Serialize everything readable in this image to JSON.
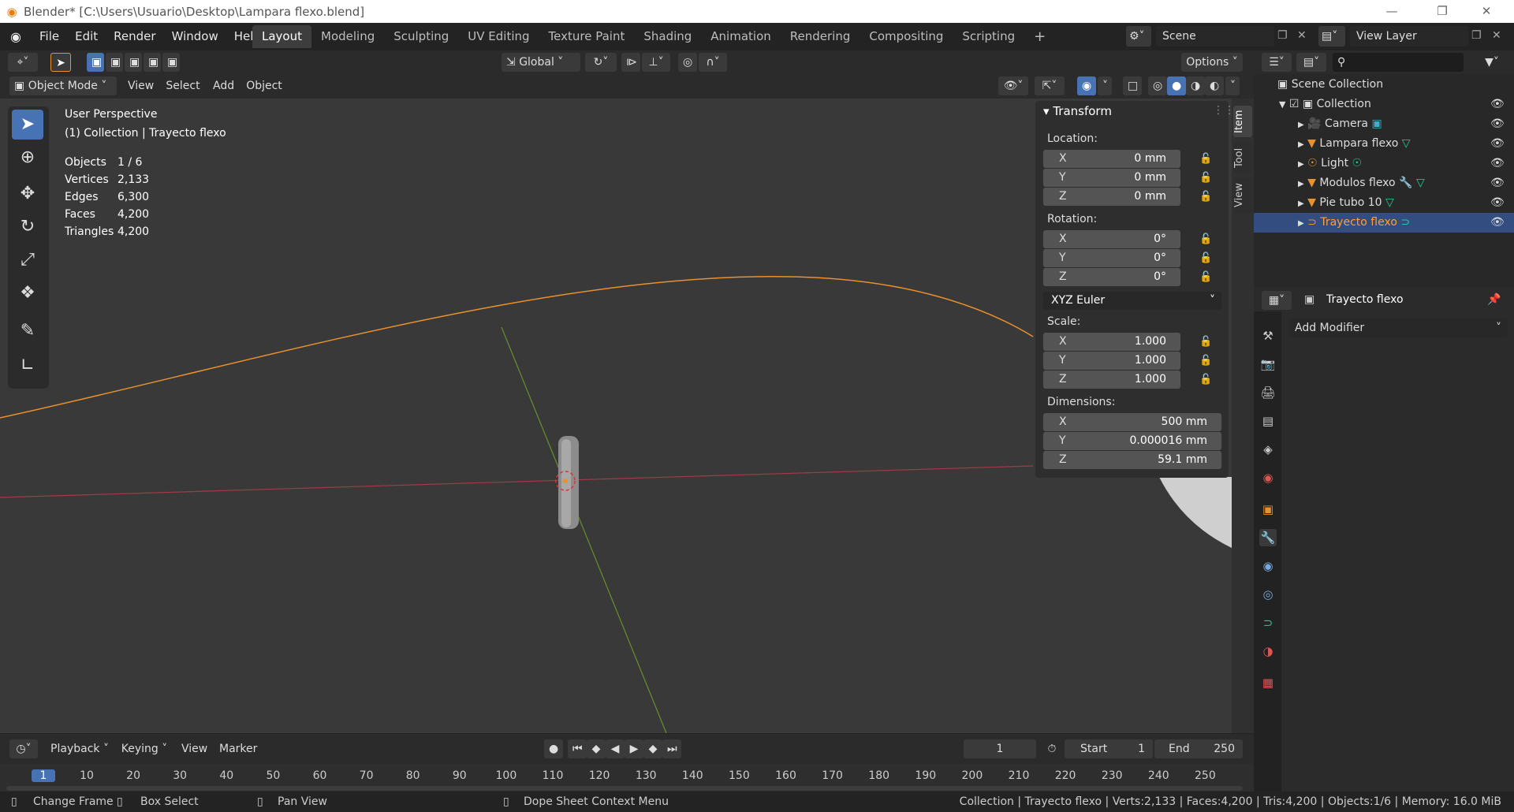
{
  "window": {
    "title": "Blender* [C:\\Users\\Usuario\\Desktop\\Lampara flexo.blend]"
  },
  "menu": {
    "file": "File",
    "edit": "Edit",
    "render": "Render",
    "window": "Window",
    "help": "Help"
  },
  "workspaces": [
    "Layout",
    "Modeling",
    "Sculpting",
    "UV Editing",
    "Texture Paint",
    "Shading",
    "Animation",
    "Rendering",
    "Compositing",
    "Scripting"
  ],
  "scene": {
    "name": "Scene",
    "view_layer": "View Layer"
  },
  "header": {
    "orientation": "Global",
    "options": "Options"
  },
  "viewport_header": {
    "mode": "Object Mode",
    "view": "View",
    "select": "Select",
    "add": "Add",
    "object": "Object"
  },
  "overlay": {
    "perspective": "User Perspective",
    "collection": "(1) Collection | Trayecto flexo",
    "stats": [
      {
        "label": "Objects",
        "value": "1 / 6"
      },
      {
        "label": "Vertices",
        "value": "2,133"
      },
      {
        "label": "Edges",
        "value": "6,300"
      },
      {
        "label": "Faces",
        "value": "4,200"
      },
      {
        "label": "Triangles",
        "value": "4,200"
      }
    ]
  },
  "npanel": {
    "title": "Transform",
    "tabs": [
      "Item",
      "Tool",
      "View"
    ],
    "location_label": "Location:",
    "location": [
      {
        "axis": "X",
        "value": "0 mm"
      },
      {
        "axis": "Y",
        "value": "0 mm"
      },
      {
        "axis": "Z",
        "value": "0 mm"
      }
    ],
    "rotation_label": "Rotation:",
    "rotation": [
      {
        "axis": "X",
        "value": "0°"
      },
      {
        "axis": "Y",
        "value": "0°"
      },
      {
        "axis": "Z",
        "value": "0°"
      }
    ],
    "rotation_mode": "XYZ Euler",
    "scale_label": "Scale:",
    "scale": [
      {
        "axis": "X",
        "value": "1.000"
      },
      {
        "axis": "Y",
        "value": "1.000"
      },
      {
        "axis": "Z",
        "value": "1.000"
      }
    ],
    "dimensions_label": "Dimensions:",
    "dimensions": [
      {
        "axis": "X",
        "value": "500 mm"
      },
      {
        "axis": "Y",
        "value": "0.000016 mm"
      },
      {
        "axis": "Z",
        "value": "59.1 mm"
      }
    ]
  },
  "outliner": {
    "root": "Scene Collection",
    "collection": "Collection",
    "items": [
      {
        "name": "Camera",
        "icon": "camera-icon"
      },
      {
        "name": "Lampara flexo",
        "icon": "mesh-icon"
      },
      {
        "name": "Light",
        "icon": "light-icon"
      },
      {
        "name": "Modulos flexo",
        "icon": "mesh-icon"
      },
      {
        "name": "Pie tubo 10",
        "icon": "mesh-icon"
      },
      {
        "name": "Trayecto flexo",
        "icon": "curve-icon",
        "selected": true
      }
    ]
  },
  "properties": {
    "object": "Trayecto flexo",
    "add_modifier": "Add Modifier"
  },
  "timeline": {
    "playback": "Playback",
    "keying": "Keying",
    "view": "View",
    "marker": "Marker",
    "current_frame": "1",
    "start_label": "Start",
    "start": "1",
    "end_label": "End",
    "end": "250",
    "ticks": [
      "1",
      "10",
      "20",
      "30",
      "40",
      "50",
      "60",
      "70",
      "80",
      "90",
      "100",
      "110",
      "120",
      "130",
      "140",
      "150",
      "160",
      "170",
      "180",
      "190",
      "200",
      "210",
      "220",
      "230",
      "240",
      "250"
    ]
  },
  "status": {
    "change_frame": "Change Frame",
    "box_select": "Box Select",
    "pan_view": "Pan View",
    "context_menu": "Dope Sheet Context Menu",
    "info": "Collection | Trayecto flexo | Verts:2,133 | Faces:4,200 | Tris:4,200 | Objects:1/6 | Memory: 16.0 MiB"
  },
  "colors": {
    "accent": "#4772b3",
    "selected_text": "#ff9e3d",
    "curve": "#e8912d",
    "x_axis": "#a33a46",
    "y_axis": "#6a8f2c"
  }
}
